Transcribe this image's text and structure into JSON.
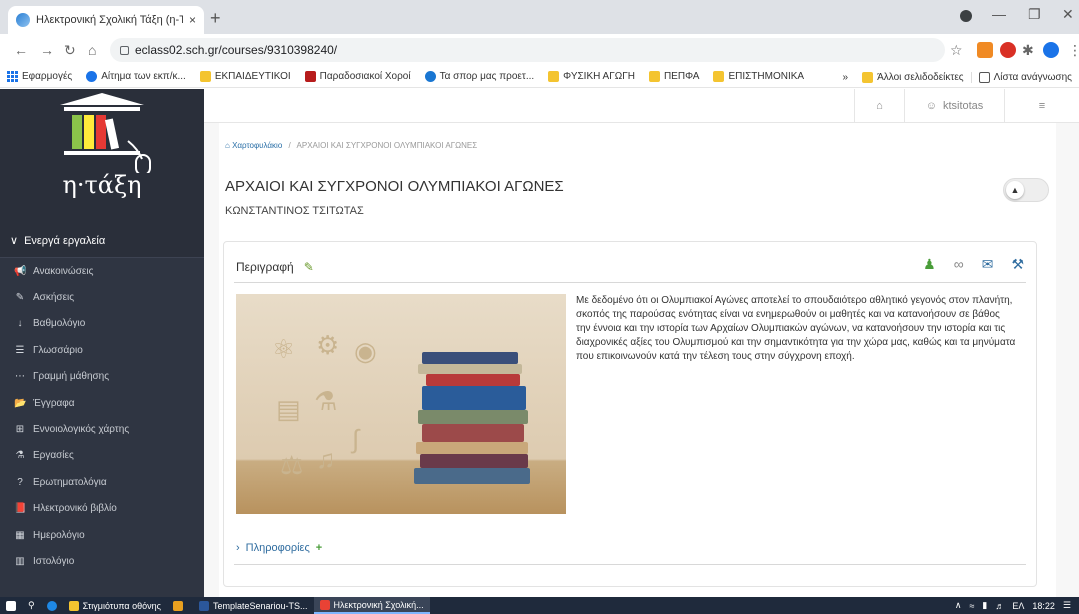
{
  "browser": {
    "tab_title": "Ηλεκτρονική Σχολική Τάξη (η-Τάξη)",
    "tab_close": "×",
    "new_tab": "+",
    "url": "eclass02.sch.gr/courses/9310398240/",
    "bookmarks": [
      {
        "label": "Εφαρμογές",
        "icon": "apps-grid-icon"
      },
      {
        "label": "Αίτημα των εκπ/κ...",
        "icon": "globe-icon"
      },
      {
        "label": "ΕΚΠΑΙΔΕΥΤΙΚΟΙ",
        "icon": "folder-icon"
      },
      {
        "label": "Παραδοσιακοί Χοροί",
        "icon": "page-icon"
      },
      {
        "label": "Τα σπορ μας προετ...",
        "icon": "star-icon"
      },
      {
        "label": "ΦΥΣΙΚΗ ΑΓΩΓΗ",
        "icon": "folder-icon"
      },
      {
        "label": "ΠΕΠΦΑ",
        "icon": "folder-icon"
      },
      {
        "label": "ΕΠΙΣΤΗΜΟΝΙΚΑ",
        "icon": "folder-icon"
      }
    ],
    "bookmarks_more": "»",
    "other_bookmarks": "Άλλοι σελιδοδείκτες",
    "reading_list": "Λίστα ανάγνωσης"
  },
  "sidebar": {
    "logo_text": "η·τάξη",
    "tools_header": "Ενεργά εργαλεία",
    "items": [
      {
        "label": "Ανακοινώσεις",
        "icon": "bullhorn-icon",
        "glyph": "📢"
      },
      {
        "label": "Ασκήσεις",
        "icon": "pencil-square-icon",
        "glyph": "✎"
      },
      {
        "label": "Βαθμολόγιο",
        "icon": "sort-numeric-icon",
        "glyph": "↓"
      },
      {
        "label": "Γλωσσάριο",
        "icon": "list-icon",
        "glyph": "☰"
      },
      {
        "label": "Γραμμή μάθησης",
        "icon": "ellipsis-icon",
        "glyph": "⋯"
      },
      {
        "label": "Έγγραφα",
        "icon": "folder-open-icon",
        "glyph": "📂"
      },
      {
        "label": "Εννοιολογικός χάρτης",
        "icon": "sitemap-icon",
        "glyph": "⊞"
      },
      {
        "label": "Εργασίες",
        "icon": "flask-icon",
        "glyph": "⚗"
      },
      {
        "label": "Ερωτηματολόγια",
        "icon": "question-circle-icon",
        "glyph": "?"
      },
      {
        "label": "Ηλεκτρονικό βιβλίο",
        "icon": "book-icon",
        "glyph": "📕"
      },
      {
        "label": "Ημερολόγιο",
        "icon": "calendar-icon",
        "glyph": "▦"
      },
      {
        "label": "Ιστολόγιο",
        "icon": "columns-icon",
        "glyph": "▥"
      }
    ]
  },
  "topbar": {
    "username": "ktsitotas"
  },
  "breadcrumb": {
    "home": "Χαρτοφυλάκιο",
    "separator": "/",
    "current": "ΑΡΧΑΙΟΙ ΚΑΙ ΣΥΓΧΡΟΝΟΙ ΟΛΥΜΠΙΑΚΟΙ ΑΓΩΝΕΣ"
  },
  "course": {
    "title": "ΑΡΧΑΙΟΙ ΚΑΙ ΣΥΓΧΡΟΝΟΙ ΟΛΥΜΠΙΑΚΟΙ ΑΓΩΝΕΣ",
    "professor": "ΚΩΝΣΤΑΝΤΙΝΟΣ ΤΣΙΤΩΤΑΣ"
  },
  "panel": {
    "heading": "Περιγραφή",
    "description": "Με δεδομένο ότι οι Ολυμπιακοί Αγώνες αποτελεί το σπουδαιότερο αθλητικό γεγονός στον πλανήτη, σκοπός της παρούσας ενότητας είναι να ενημερωθούν οι μαθητές και να κατανοήσουν σε βάθος την έννοια και την ιστορία των Αρχαίων Ολυμπιακών αγώνων, να κατανοήσουν την ιστορία και τις διαχρονικές αξίες του Ολυμπισμού και την σημαντικότητα για την χώρα μας, καθώς και τα μηνύματα που επικοινωνούν κατά την τέλεση τους στην σύγχρονη εποχή.",
    "info_label": "Πληροφορίες"
  },
  "taskbar": {
    "items": [
      {
        "label": "Στιγμιότυπα οθόνης",
        "color": "#f4c430"
      },
      {
        "label": "",
        "color": "#e8a020"
      },
      {
        "label": "TemplateSenariou-TS...",
        "color": "#2b579a"
      },
      {
        "label": "Ηλεκτρονική Σχολική...",
        "color": "#e94235"
      }
    ],
    "lang": "ΕΛ",
    "time": "18:22"
  },
  "colors": {
    "sidebar_bg": "#2f3542",
    "link_blue": "#2f6c9f",
    "edit_green": "#6a9a2c"
  }
}
